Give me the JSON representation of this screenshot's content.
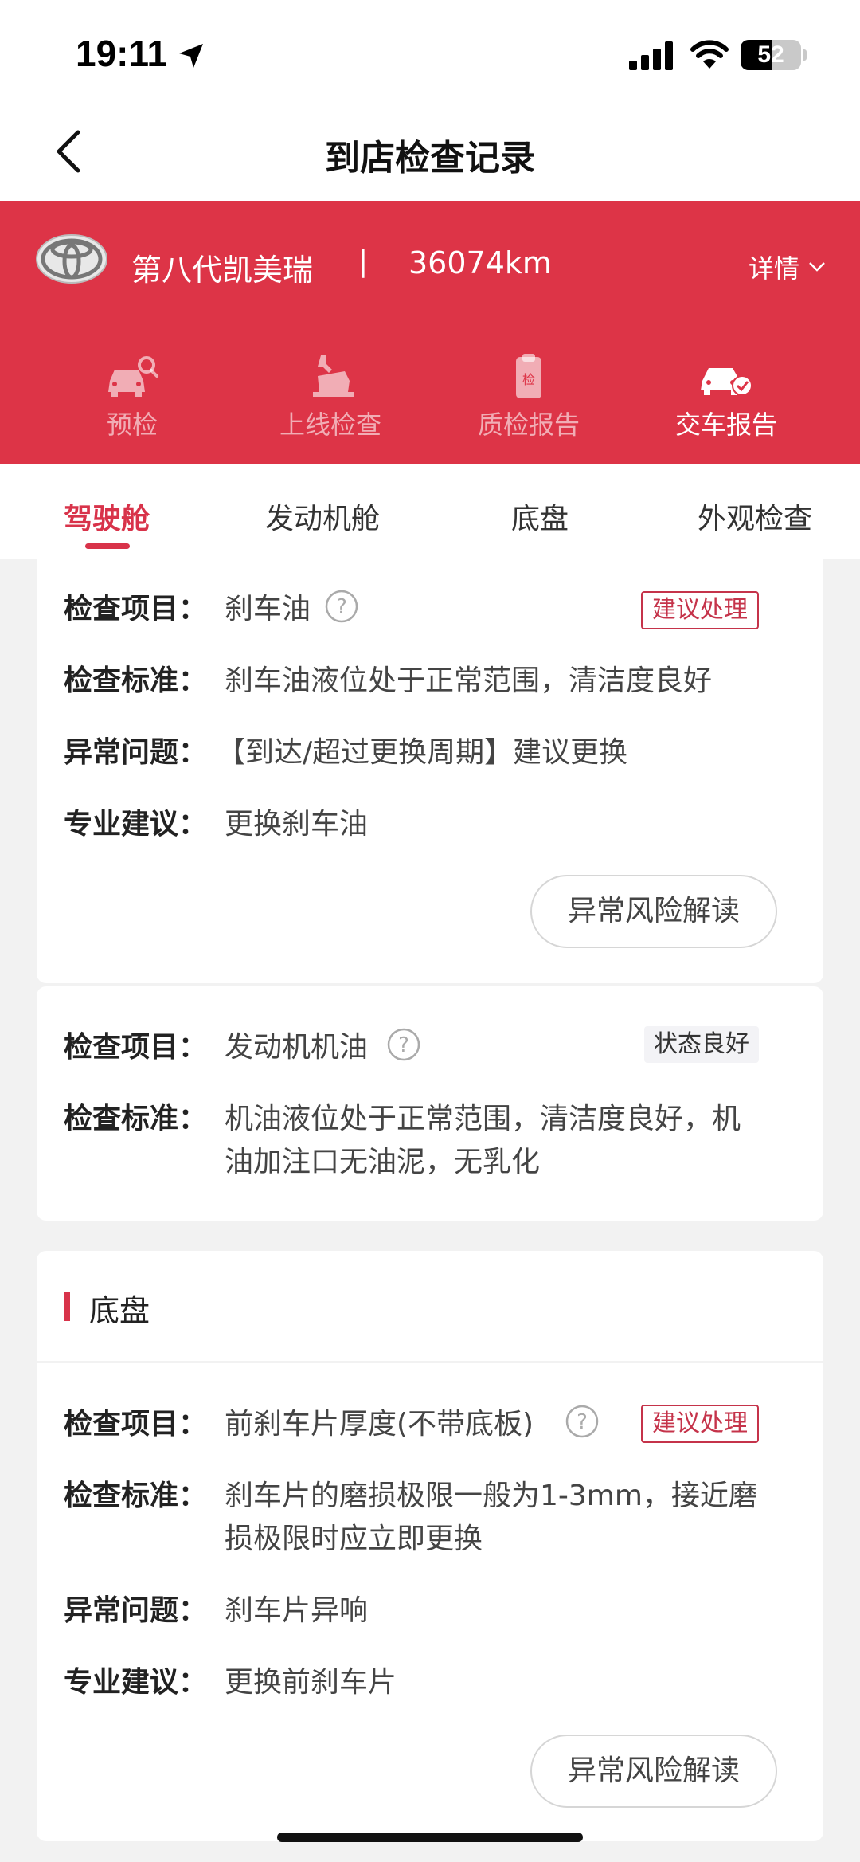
{
  "status_bar": {
    "time": "19:11",
    "battery": "52"
  },
  "nav": {
    "title": "到店检查记录"
  },
  "vehicle": {
    "model": "第八代凯美瑞",
    "separator": "|",
    "mileage": "36074km",
    "detail_label": "详情"
  },
  "functions": [
    {
      "label": "预检",
      "icon": "car-search-icon",
      "active": false
    },
    {
      "label": "上线检查",
      "icon": "lift-wrench-icon",
      "active": false
    },
    {
      "label": "质检报告",
      "icon": "clipboard-check-icon",
      "active": false
    },
    {
      "label": "交车报告",
      "icon": "car-check-icon",
      "active": true
    }
  ],
  "functions_clip_text": "检",
  "tabs": [
    {
      "label": "驾驶舱",
      "active": true
    },
    {
      "label": "发动机舱",
      "active": false
    },
    {
      "label": "底盘",
      "active": false
    },
    {
      "label": "外观检查",
      "active": false
    }
  ],
  "labels": {
    "item": "检查项目：",
    "standard": "检查标准：",
    "issue": "异常问题：",
    "advice": "专业建议："
  },
  "cards": [
    {
      "item": "刹车油",
      "tag": "建议处理",
      "standard": "刹车油液位处于正常范围，清洁度良好",
      "issue": "【到达/超过更换周期】建议更换",
      "advice": "更换刹车油",
      "button": "异常风险解读"
    },
    {
      "item": "发动机机油",
      "tag": "状态良好",
      "standard_line1": "机油液位处于正常范围，清洁度良好，机",
      "standard_line2": "油加注口无油泥，无乳化"
    },
    {
      "item": "前刹车片厚度(不带底板)",
      "tag": "建议处理",
      "standard_line1": "刹车片的磨损极限一般为1-3mm，接近磨",
      "standard_line2": "损极限时应立即更换",
      "issue": "刹车片异响",
      "advice": "更换前刹车片",
      "button": "异常风险解读"
    }
  ],
  "section": {
    "title": "底盘"
  },
  "colors": {
    "brand_red": "#dd3447",
    "tag_red": "#c5334a"
  }
}
